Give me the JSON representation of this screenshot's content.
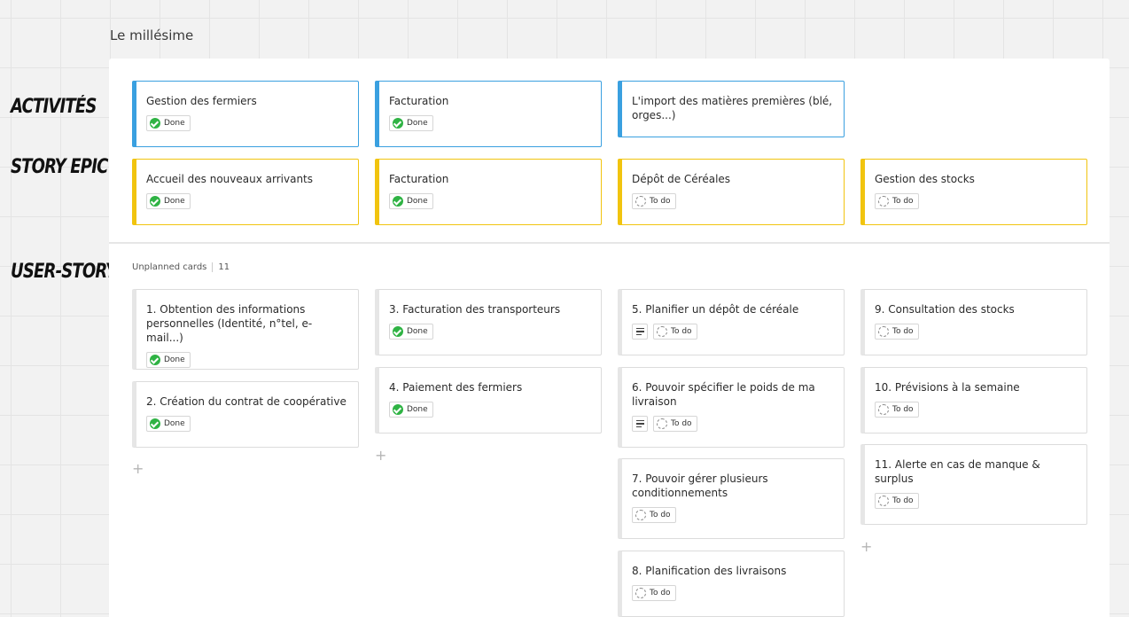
{
  "board_title": "Le millésime",
  "row_labels": {
    "activities": "ACTIVITÉS",
    "story_epic": "STORY EPIC",
    "user_story": "USER-STORY"
  },
  "unplanned": {
    "label": "Unplanned cards",
    "count": "11"
  },
  "status": {
    "done": "Done",
    "todo": "To do"
  },
  "activities": [
    {
      "title": "Gestion des fermiers",
      "status": "Done"
    },
    {
      "title": "Facturation",
      "status": "Done"
    },
    {
      "title": "L'import des matières premières (blé, orges...)",
      "status": ""
    }
  ],
  "epics": [
    {
      "title": "Accueil des nouveaux arrivants",
      "status": "Done"
    },
    {
      "title": "Facturation",
      "status": "Done"
    },
    {
      "title": "Dépôt de Céréales",
      "status": "To do"
    },
    {
      "title": "Gestion des stocks",
      "status": "To do"
    }
  ],
  "stories": [
    {
      "title": "1. Obtention des informations personnelles (Identité, n°tel, e-mail...)",
      "status": "Done"
    },
    {
      "title": "2. Création du contrat de coopérative",
      "status": "Done"
    },
    {
      "title": "3. Facturation des transporteurs",
      "status": "Done"
    },
    {
      "title": "4. Paiement des fermiers",
      "status": "Done"
    },
    {
      "title": "5. Planifier un dépôt de céréale",
      "status": "To do"
    },
    {
      "title": "6. Pouvoir spécifier le poids de ma livraison",
      "status": "To do"
    },
    {
      "title": "7. Pouvoir gérer plusieurs conditionnements",
      "status": "To do"
    },
    {
      "title": "8. Planification des livraisons",
      "status": "To do"
    },
    {
      "title": "9. Consultation des stocks",
      "status": "To do"
    },
    {
      "title": "10. Prévisions à la semaine",
      "status": "To do"
    },
    {
      "title": "11. Alerte en cas de manque & surplus",
      "status": "To do"
    }
  ],
  "icons": {
    "done": "check-circle-icon",
    "todo": "dashed-circle-icon",
    "description": "description-lines-icon",
    "add": "plus-icon"
  },
  "colors": {
    "activity_accent": "#3aa0e0",
    "epic_accent": "#f1c40f",
    "done_green": "#2fb344"
  }
}
